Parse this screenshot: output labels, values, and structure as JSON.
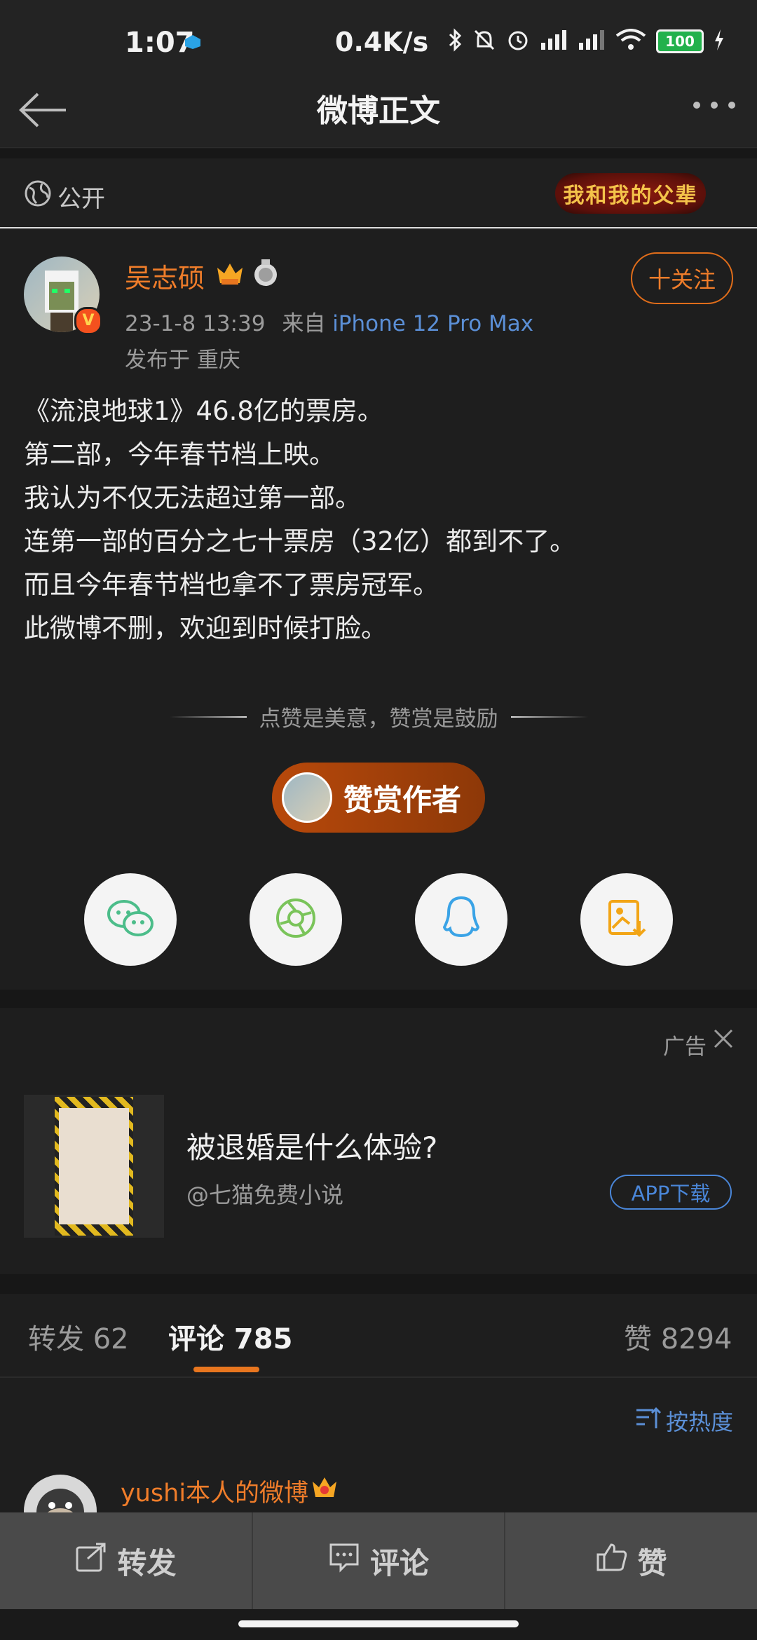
{
  "status_bar": {
    "time": "1:07",
    "net_speed": "0.4K/s",
    "battery": "100"
  },
  "nav": {
    "title": "微博正文"
  },
  "visibility": {
    "label": "公开",
    "banner_text": "我和我的父辈"
  },
  "author": {
    "name": "吴志硕",
    "timestamp": "23-1-8 13:39",
    "source_prefix": "来自",
    "device": "iPhone 12 Pro Max",
    "location": "发布于 重庆",
    "follow_label": "十关注"
  },
  "post": {
    "lines": [
      "《流浪地球1》46.8亿的票房。",
      "第二部，今年春节档上映。",
      "我认为不仅无法超过第一部。",
      "连第一部的百分之七十票房（32亿）都到不了。",
      "而且今年春节档也拿不了票房冠军。",
      "此微博不删，欢迎到时候打脸。"
    ]
  },
  "reward": {
    "tagline": "点赞是美意，赞赏是鼓励",
    "button_label": "赞赏作者"
  },
  "share_icons": [
    "wechat-icon",
    "moments-icon",
    "qq-icon",
    "save-image-icon"
  ],
  "ad": {
    "label": "广告",
    "title": "被退婚是什么体验?",
    "source": "@七猫免费小说",
    "button_label": "APP下载"
  },
  "tabs": {
    "repost": "转发 62",
    "comment": "评论 785",
    "like": "赞 8294"
  },
  "sort": {
    "label": "按热度"
  },
  "comment": {
    "username": "yushi本人的微博"
  },
  "bottom_bar": {
    "repost": "转发",
    "comment": "评论",
    "like": "赞"
  },
  "colors": {
    "accent": "#f07d2a",
    "link": "#5b8fd6",
    "background": "#1e1e1e"
  }
}
